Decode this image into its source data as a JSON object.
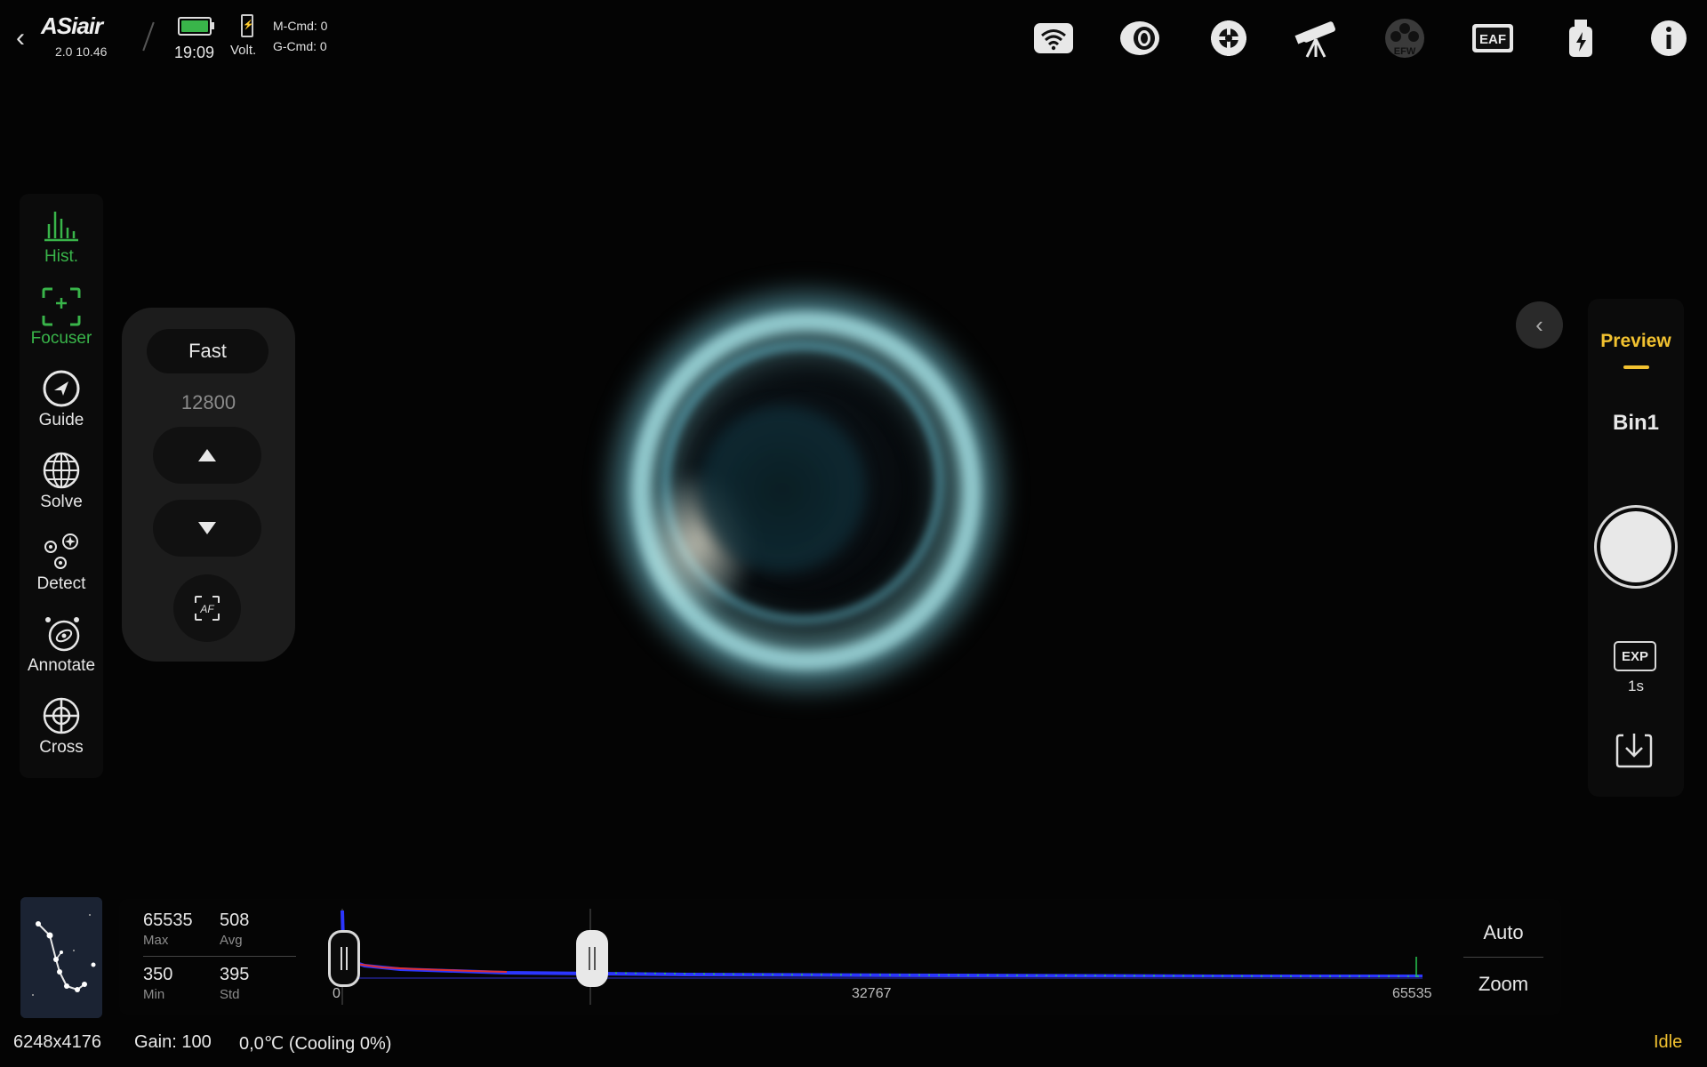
{
  "app": {
    "logo": "ASiair",
    "version": "2.0 10.46",
    "back_icon": "chevron-left-icon"
  },
  "status_bar": {
    "time": "19:09",
    "volt_label": "Volt.",
    "m_cmd": "M-Cmd: 0",
    "g_cmd": "G-Cmd: 0",
    "battery_color": "#39b54a",
    "device_icons": [
      "wifi-icon",
      "camera-icon",
      "guide-scope-icon",
      "telescope-mount-icon",
      "efw-icon",
      "eaf-icon",
      "usb-storage-icon",
      "info-icon"
    ],
    "efw_label": "EFW",
    "eaf_label": "EAF"
  },
  "sidebar": {
    "items": [
      {
        "label": "Hist.",
        "icon": "histogram-icon",
        "active": true
      },
      {
        "label": "Focuser",
        "icon": "focuser-icon",
        "active": true
      },
      {
        "label": "Guide",
        "icon": "guide-icon",
        "active": false
      },
      {
        "label": "Solve",
        "icon": "globe-icon",
        "active": false
      },
      {
        "label": "Detect",
        "icon": "detect-stars-icon",
        "active": false
      },
      {
        "label": "Annotate",
        "icon": "annotate-icon",
        "active": false
      },
      {
        "label": "Cross",
        "icon": "crosshair-icon",
        "active": false
      }
    ]
  },
  "focuser": {
    "speed": "Fast",
    "position": "12800",
    "af_label": "AF"
  },
  "right_panel": {
    "mode": "Preview",
    "bin": "Bin1",
    "exp_label": "EXP",
    "exposure": "1s",
    "accent": "#f2c230"
  },
  "histogram": {
    "max": "65535",
    "max_label": "Max",
    "avg": "508",
    "avg_label": "Avg",
    "min": "350",
    "min_label": "Min",
    "std": "395",
    "std_label": "Std",
    "tick_left": "0",
    "tick_mid": "32767",
    "tick_right": "65535",
    "auto_label": "Auto",
    "zoom_label": "Zoom"
  },
  "footer": {
    "resolution": "6248x4176",
    "gain": "Gain: 100",
    "temperature": "0,0℃ (Cooling 0%)",
    "state": "Idle"
  }
}
